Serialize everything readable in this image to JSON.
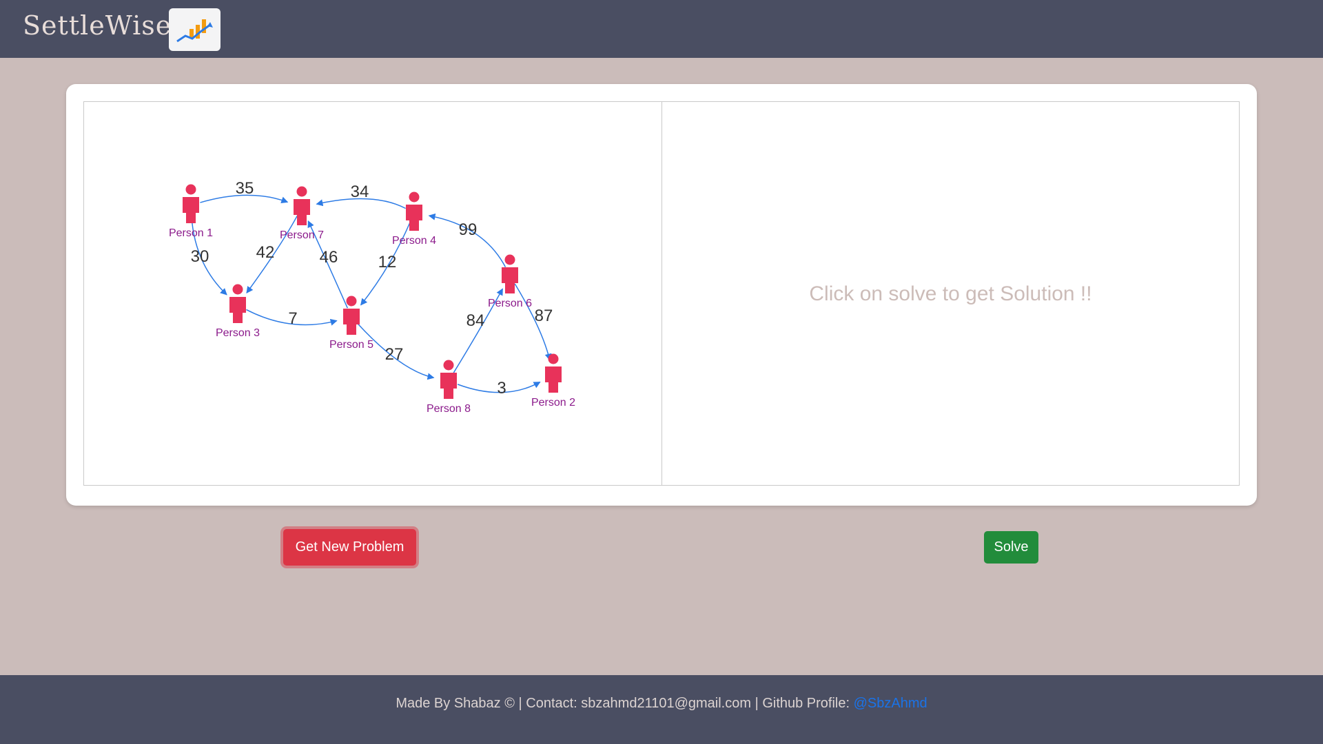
{
  "navbar": {
    "brand": "SettleWise",
    "logo_icon": "chart-trend-icon"
  },
  "graph": {
    "nodes": [
      {
        "id": "p1",
        "label": "Person 1"
      },
      {
        "id": "p7",
        "label": "Person 7"
      },
      {
        "id": "p4",
        "label": "Person 4"
      },
      {
        "id": "p3",
        "label": "Person 3"
      },
      {
        "id": "p5",
        "label": "Person 5"
      },
      {
        "id": "p6",
        "label": "Person 6"
      },
      {
        "id": "p8",
        "label": "Person 8"
      },
      {
        "id": "p2",
        "label": "Person 2"
      }
    ],
    "edges": [
      {
        "from": "Person 1",
        "to": "Person 7",
        "amount": "35"
      },
      {
        "from": "Person 4",
        "to": "Person 7",
        "amount": "34"
      },
      {
        "from": "Person 1",
        "to": "Person 3",
        "amount": "30"
      },
      {
        "from": "Person 7",
        "to": "Person 3",
        "amount": "42"
      },
      {
        "from": "Person 5",
        "to": "Person 7",
        "amount": "46"
      },
      {
        "from": "Person 4",
        "to": "Person 5",
        "amount": "12"
      },
      {
        "from": "Person 6",
        "to": "Person 4",
        "amount": "99"
      },
      {
        "from": "Person 3",
        "to": "Person 5",
        "amount": "7"
      },
      {
        "from": "Person 5",
        "to": "Person 8",
        "amount": "27"
      },
      {
        "from": "Person 8",
        "to": "Person 6",
        "amount": "84"
      },
      {
        "from": "Person 6",
        "to": "Person 2",
        "amount": "87"
      },
      {
        "from": "Person 8",
        "to": "Person 2",
        "amount": "3"
      }
    ],
    "colors": {
      "person": "#e8325a",
      "edge": "#2d7be5",
      "label": "#8b1a8b"
    }
  },
  "solution": {
    "placeholder": "Click on solve to get Solution !!"
  },
  "buttons": {
    "new_problem": "Get New Problem",
    "solve": "Solve"
  },
  "footer": {
    "text": "Made By Shabaz © | Contact: sbzahmd21101@gmail.com | Github Profile: ",
    "link_text": "@SbzAhmd"
  }
}
